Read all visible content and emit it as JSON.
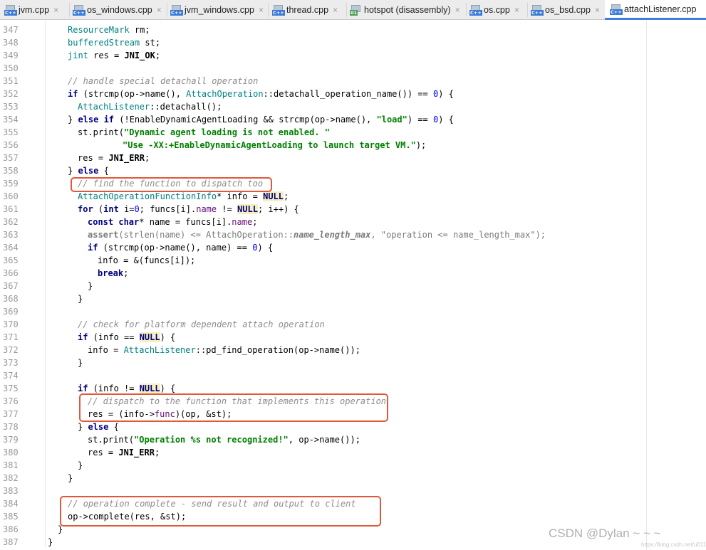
{
  "tabs": [
    {
      "label": "jvm.cpp",
      "icon": "cpp-file-icon"
    },
    {
      "label": "os_windows.cpp",
      "icon": "cpp-file-icon"
    },
    {
      "label": "jvm_windows.cpp",
      "icon": "cpp-file-icon"
    },
    {
      "label": "thread.cpp",
      "icon": "cpp-file-icon"
    },
    {
      "label": "hotspot (disassembly)",
      "icon": "disassembly-file-icon"
    },
    {
      "label": "os.cpp",
      "icon": "cpp-file-icon"
    },
    {
      "label": "os_bsd.cpp",
      "icon": "cpp-file-icon"
    },
    {
      "label": "attachListener.cpp",
      "icon": "cpp-file-icon",
      "active": true
    }
  ],
  "tab_close_glyph": "×",
  "icon_labels": {
    "cpp": "C++",
    "disasm": "01"
  },
  "line_numbers": [
    "347",
    "348",
    "349",
    "350",
    "351",
    "352",
    "353",
    "354",
    "355",
    "356",
    "357",
    "358",
    "359",
    "360",
    "361",
    "362",
    "363",
    "364",
    "365",
    "366",
    "367",
    "368",
    "369",
    "370",
    "371",
    "372",
    "373",
    "374",
    "375",
    "376",
    "377",
    "378",
    "379",
    "380",
    "381",
    "382",
    "383",
    "384",
    "385",
    "386",
    "387"
  ],
  "code": {
    "l347": [
      "ResourceMark",
      " rm;"
    ],
    "l348": [
      "bufferedStream",
      " st;"
    ],
    "l349": [
      "jint",
      " res = ",
      "JNI_OK",
      ";"
    ],
    "l351": [
      "// handle special detachall operation"
    ],
    "l352": [
      "if",
      " (strcmp(op->name(), ",
      "AttachOperation",
      "::detachall_operation_name()) == ",
      "0",
      ") {"
    ],
    "l353": [
      "AttachListener",
      "::detachall();"
    ],
    "l354": [
      "} ",
      "else if",
      " (!EnableDynamicAgentLoading && strcmp(op->name(), ",
      "\"load\"",
      ") == ",
      "0",
      ") {"
    ],
    "l355": [
      "st.print(",
      "\"Dynamic agent loading is not enabled. \""
    ],
    "l356": [
      "\"Use -XX:+EnableDynamicAgentLoading to launch target VM.\"",
      ");"
    ],
    "l357": [
      "res = ",
      "JNI_ERR",
      ";"
    ],
    "l358": [
      "} ",
      "else",
      " {"
    ],
    "l359": [
      "// find the function to dispatch too"
    ],
    "l360": [
      "AttachOperationFunctionInfo",
      "* info = ",
      "NULL",
      ";"
    ],
    "l361": [
      "for",
      " (",
      "int",
      " i=",
      "0",
      "; funcs[i].",
      "name",
      " != ",
      "NULL",
      "; i++) {"
    ],
    "l362": [
      "const char",
      "* name = funcs[i].",
      "name",
      ";"
    ],
    "l363": [
      "assert",
      "(strlen(name) <= AttachOperation::",
      "name_length_max",
      ", \"operation <= name_length_max\");"
    ],
    "l364": [
      "if",
      " (strcmp(op->name(), name) == ",
      "0",
      ") {"
    ],
    "l365": [
      "info = &(funcs[i]);"
    ],
    "l366": [
      "break",
      ";"
    ],
    "l367": [
      "}"
    ],
    "l368": [
      "}"
    ],
    "l370": [
      "// check for platform dependent attach operation"
    ],
    "l371": [
      "if",
      " (info == ",
      "NULL",
      ") {"
    ],
    "l372": [
      "info = ",
      "AttachListener",
      "::pd_find_operation(op->name());"
    ],
    "l373": [
      "}"
    ],
    "l375": [
      "if",
      " (info != ",
      "NULL",
      ") {"
    ],
    "l376": [
      "// dispatch to the function that implements this operation"
    ],
    "l377": [
      "res = (info->",
      "func",
      ")(op, &st);"
    ],
    "l378": [
      "} ",
      "else",
      " {"
    ],
    "l379": [
      "st.print(",
      "\"Operation %s not recognized!\"",
      ", op->name());"
    ],
    "l380": [
      "res = ",
      "JNI_ERR",
      ";"
    ],
    "l381": [
      "}"
    ],
    "l382": [
      "}"
    ],
    "l384": [
      "// operation complete - send result and output to client"
    ],
    "l385": [
      "op->complete(res, &st);"
    ],
    "l386": [
      "}"
    ],
    "l387": [
      "}"
    ]
  },
  "watermark": "CSDN @Dylan ~ ~ ~",
  "watermark_small": "https://blog.csdn.net/u011150"
}
